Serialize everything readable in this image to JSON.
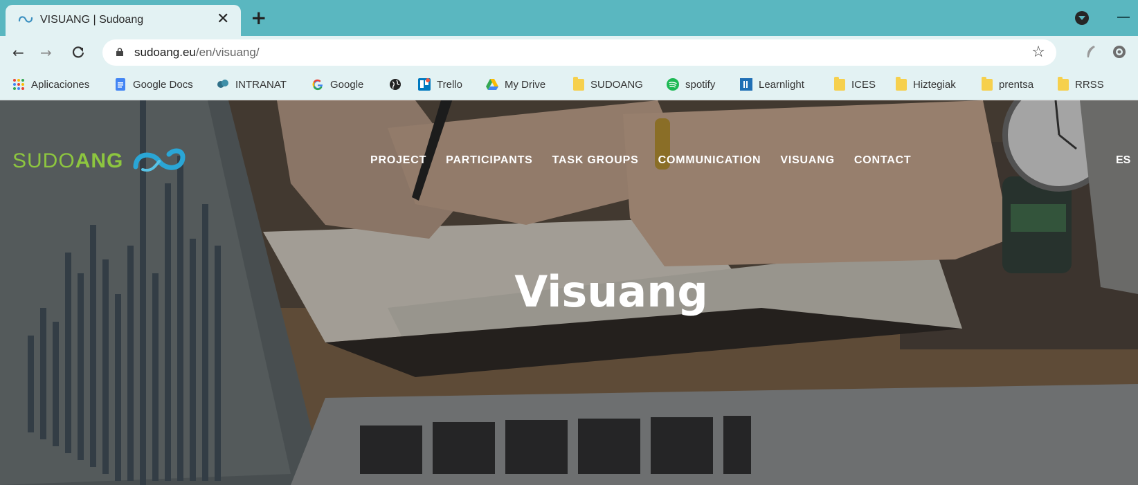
{
  "browser": {
    "tab_title": "VISUANG | Sudoang",
    "new_tab_label": "+",
    "close_label": "✕",
    "url_host": "sudoang.eu",
    "url_path": "/en/visuang/"
  },
  "bookmarks": [
    {
      "label": "Aplicaciones",
      "icon": "apps-grid-icon"
    },
    {
      "label": "Google Docs",
      "icon": "google-docs-icon"
    },
    {
      "label": "INTRANAT",
      "icon": "intranat-icon"
    },
    {
      "label": "Google",
      "icon": "google-icon"
    },
    {
      "label": "",
      "icon": "globe-icon"
    },
    {
      "label": "Trello",
      "icon": "trello-icon"
    },
    {
      "label": "My Drive",
      "icon": "google-drive-icon"
    },
    {
      "label": "SUDOANG",
      "icon": "folder-icon"
    },
    {
      "label": "spotify",
      "icon": "spotify-icon"
    },
    {
      "label": "Learnlight",
      "icon": "learnlight-icon"
    },
    {
      "label": "ICES",
      "icon": "folder-icon"
    },
    {
      "label": "Hiztegiak",
      "icon": "folder-icon"
    },
    {
      "label": "prentsa",
      "icon": "folder-icon"
    },
    {
      "label": "RRSS",
      "icon": "folder-icon"
    }
  ],
  "site": {
    "logo_text_light": "SUDO",
    "logo_text_bold": "ANG",
    "nav": [
      "PROJECT",
      "PARTICIPANTS",
      "TASK GROUPS",
      "COMMUNICATION",
      "VISUANG",
      "CONTACT"
    ],
    "language": "ES",
    "hero_title": "Visuang"
  },
  "colors": {
    "tabbar": "#5ab7c0",
    "toolbar": "#e3f2f3",
    "logo_green": "#8dc63f",
    "logo_blue": "#2aa6d6"
  }
}
